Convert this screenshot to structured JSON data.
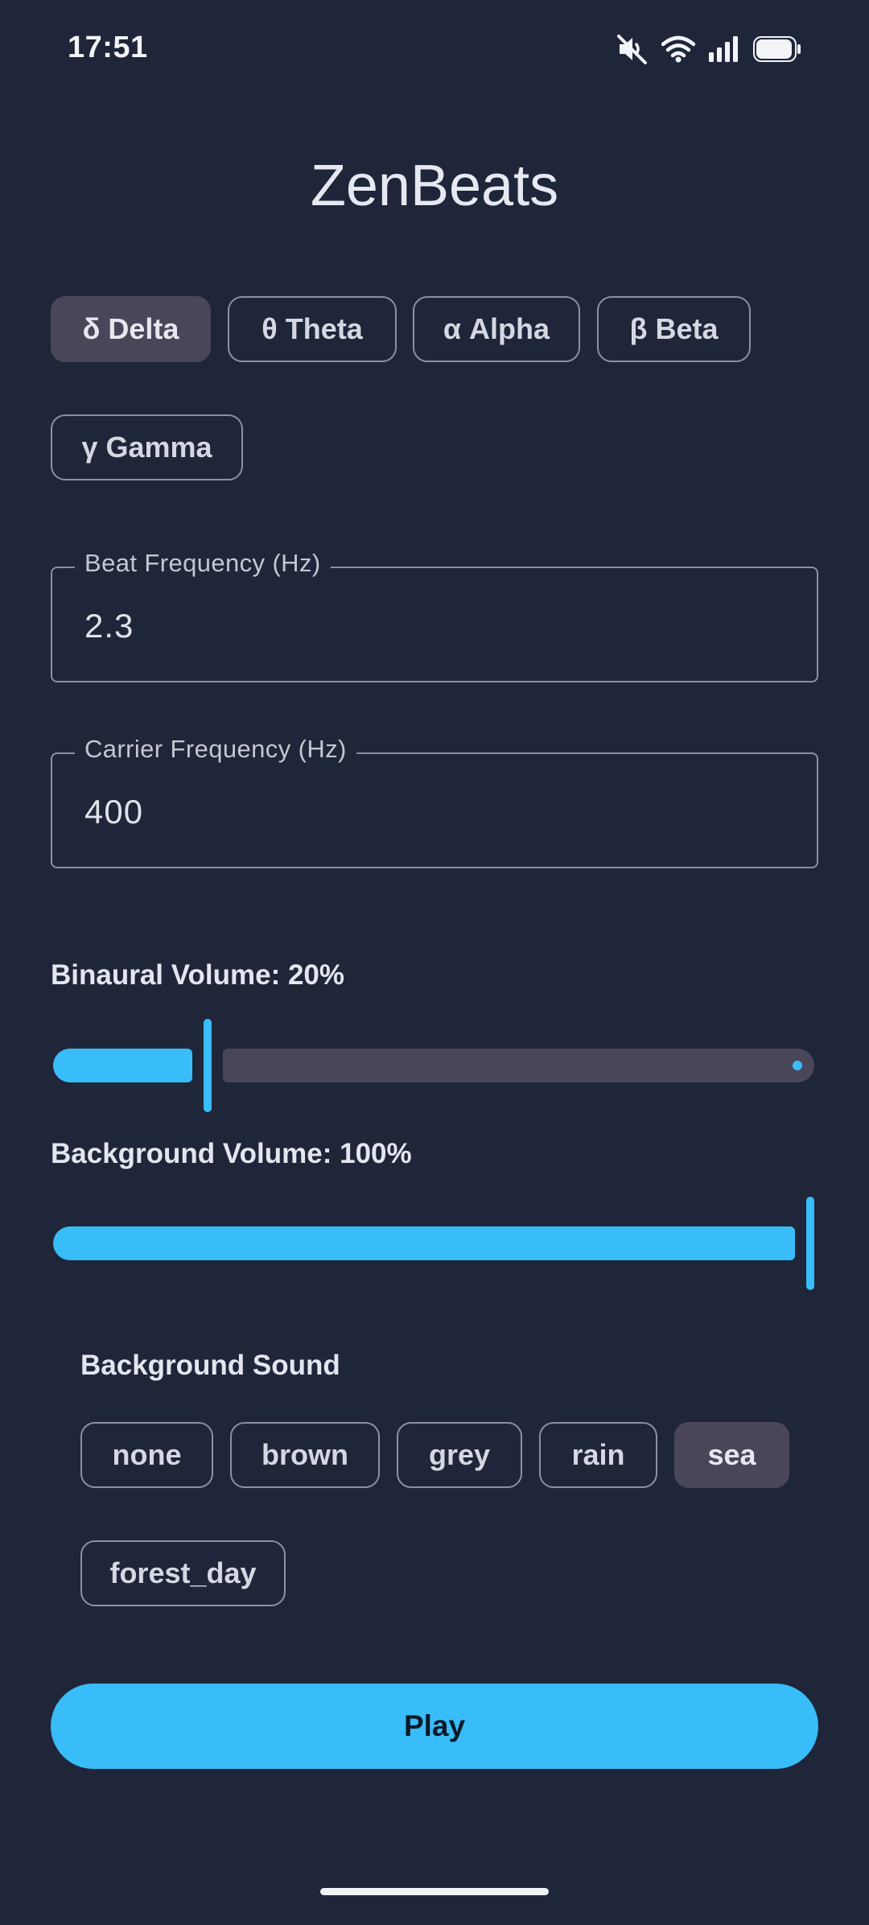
{
  "status_bar": {
    "time": "17:51",
    "icons": [
      "mute-icon",
      "wifi-icon",
      "signal-icon",
      "battery-icon"
    ]
  },
  "app": {
    "title": "ZenBeats"
  },
  "wave_presets": {
    "items": [
      {
        "label": "δ Delta",
        "selected": true
      },
      {
        "label": "θ Theta",
        "selected": false
      },
      {
        "label": "α Alpha",
        "selected": false
      },
      {
        "label": "β Beta",
        "selected": false
      },
      {
        "label": "γ Gamma",
        "selected": false
      }
    ]
  },
  "beat_frequency": {
    "label": "Beat Frequency (Hz)",
    "value": "2.3"
  },
  "carrier_frequency": {
    "label": "Carrier Frequency (Hz)",
    "value": "400"
  },
  "binaural_volume": {
    "label": "Binaural Volume: 20%",
    "value_percent": 20
  },
  "background_volume": {
    "label": "Background Volume: 100%",
    "value_percent": 100
  },
  "background_sound": {
    "label": "Background Sound",
    "items": [
      {
        "label": "none",
        "selected": false
      },
      {
        "label": "brown",
        "selected": false
      },
      {
        "label": "grey",
        "selected": false
      },
      {
        "label": "rain",
        "selected": false
      },
      {
        "label": "sea",
        "selected": true
      },
      {
        "label": "forest_day",
        "selected": false
      }
    ]
  },
  "play_button": {
    "label": "Play"
  },
  "colors": {
    "background": "#1f2639",
    "accent": "#38bdf8",
    "chip_selected": "#4a4659",
    "outline": "#8e90a0"
  }
}
